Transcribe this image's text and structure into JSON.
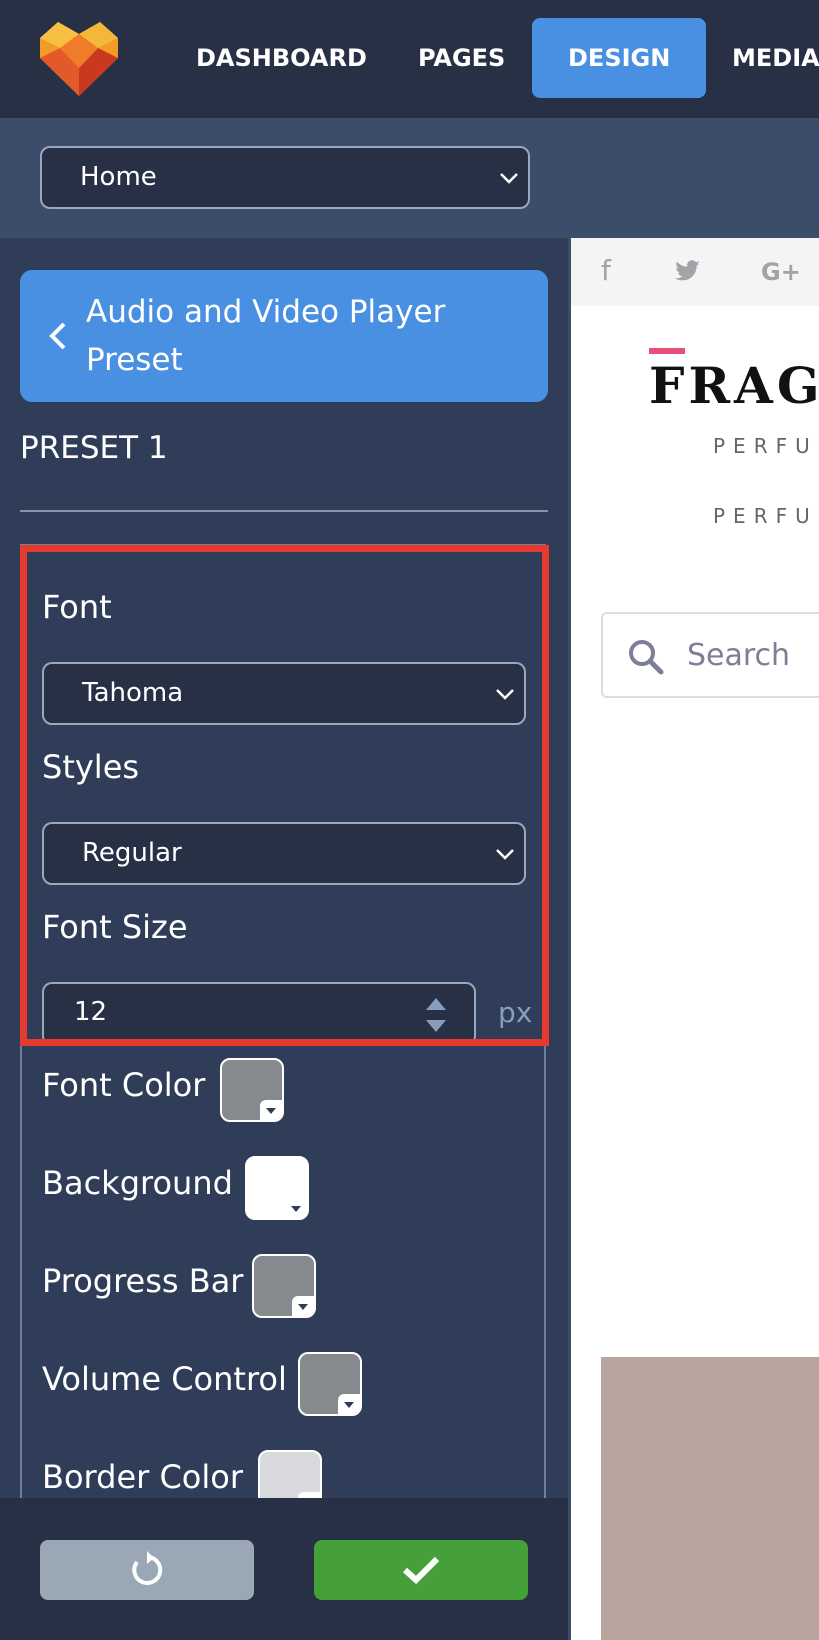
{
  "nav": {
    "items": [
      {
        "label": "DASHBOARD"
      },
      {
        "label": "PAGES"
      },
      {
        "label": "DESIGN"
      },
      {
        "label": "MEDIA L"
      }
    ]
  },
  "page_select": {
    "value": "Home"
  },
  "sidebar": {
    "back_label": "Audio and Video Player Preset",
    "preset_title": "PRESET 1",
    "font": {
      "label": "Font",
      "value": "Tahoma"
    },
    "styles": {
      "label": "Styles",
      "value": "Regular"
    },
    "font_size": {
      "label": "Font Size",
      "value": "12",
      "unit": "px"
    },
    "colors": [
      {
        "label": "Font Color",
        "color": "#868a8e"
      },
      {
        "label": "Background",
        "color": "#ffffff"
      },
      {
        "label": "Progress Bar",
        "color": "#868a8e"
      },
      {
        "label": "Volume Control",
        "color": "#868a8e"
      },
      {
        "label": "Border Color",
        "color": "#d8dade"
      }
    ]
  },
  "actions": {
    "reset_icon": "reset-icon",
    "confirm_icon": "check-icon"
  },
  "preview": {
    "social": [
      "f",
      "twitter",
      "G+"
    ],
    "logo": "FRAG",
    "tagline_1": "PERFU",
    "tagline_2": "PERFU",
    "search_placeholder": "Search"
  },
  "colors": {
    "nav_bg": "#273044",
    "accent": "#4a90e2",
    "sidebar_bg": "#2f3d59",
    "highlight": "#e63a2e",
    "confirm": "#46a03a",
    "reset": "#9aa7b5"
  }
}
